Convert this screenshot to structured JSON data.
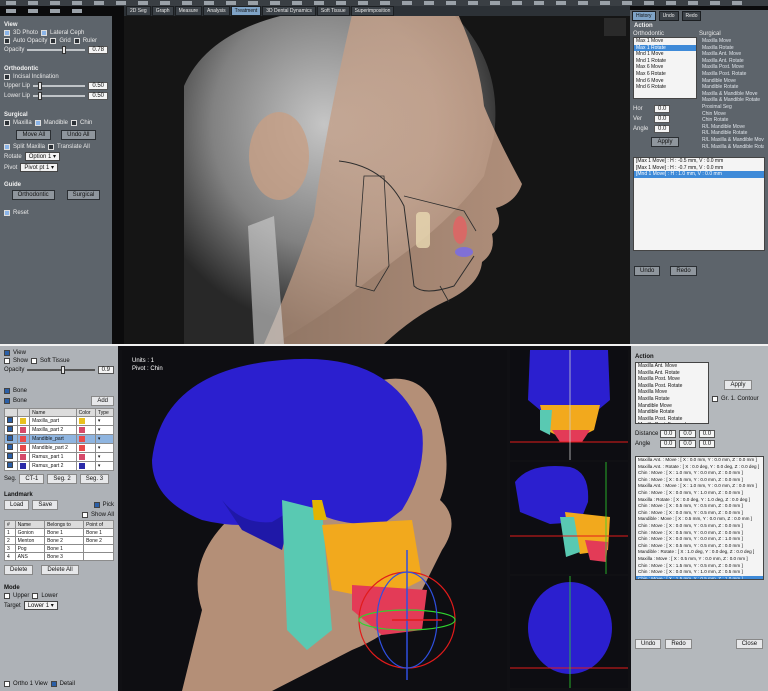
{
  "top_toolbar": {
    "tabs": [
      "2D Seg",
      "Graph",
      "Measure",
      "Analysis",
      "Treatment",
      "3D Dental Dynamics",
      "Soft Tissue",
      "Superimposition"
    ],
    "active_tab": "Treatment"
  },
  "top_left_panel": {
    "view_section": "View",
    "view_options": [
      "3D Photo",
      "Lateral Ceph",
      "Auto Opacity",
      "Grid",
      "Ruler"
    ],
    "opacity_label": "Opacity",
    "opacity_value": "0.78",
    "orthodontic_section": "Orthodontic",
    "orthodontic_option": "Incisal Inclination",
    "upper_lip_label": "Upper Lip",
    "upper_lip_value": "0.50",
    "lower_lip_label": "Lower Lip",
    "lower_lip_value": "0.50",
    "surgical_section": "Surgical",
    "surgical_options": [
      "Maxilla",
      "Mandible",
      "Chin"
    ],
    "button_a": "Move All",
    "button_b": "Undo All",
    "split_maxilla": "Split Maxilla",
    "translate_all": "Translate All",
    "rotate_label": "Rotate",
    "rotate_value": "Option 1",
    "pivot_label": "Pivot",
    "pivot_value": "Pivot pt 1",
    "guide_section": "Guide",
    "ortho_button": "Orthodontic",
    "surgical_button": "Surgical",
    "reset_label": "Reset"
  },
  "top_right_panel": {
    "tabs": [
      "History",
      "Undo",
      "Redo"
    ],
    "section": "Action",
    "col_orthodontic": "Orthodontic",
    "col_surgical": "Surgical",
    "ortho_items": [
      "Max 1 Move",
      "Max 1 Rotate",
      "Mnd 1 Move",
      "Mnd 1 Rotate",
      "Max 6 Move",
      "Max 6 Rotate",
      "Mnd 6 Move",
      "Mnd 6 Rotate"
    ],
    "ortho_selected": 1,
    "surgical_items": [
      "Maxilla Move",
      "Maxilla Rotate",
      "Maxilla Ant. Move",
      "Maxilla Ant. Rotate",
      "Maxilla Post. Move",
      "Maxilla Post. Rotate",
      "Mandible Move",
      "Mandible Rotate",
      "Maxilla & Mandible Move",
      "Maxilla & Mandible Rotate",
      "Proximal Seg",
      "Chin Move",
      "Chin Rotate",
      "R/L Mandible Move",
      "R/L Mandible Rotate",
      "R/L Maxilla & Mandible Move",
      "R/L Maxilla & Mandible Rotate"
    ],
    "field_labels": [
      "Hor",
      "Ver",
      "Angle"
    ],
    "field_values": [
      "0.0",
      "0.0",
      "0.0"
    ],
    "apply_button": "Apply",
    "history": [
      "[Max 1 Move] : H : -0.5 mm, V : 0.0 mm",
      "[Max 1 Move] : H : -0.7 mm, V : 0.0 mm",
      "[Mnd 1 Move] : H : 1.0 mm, V : 0.0 mm"
    ],
    "history_selected": 2,
    "undo_button": "Undo",
    "redo_button": "Redo"
  },
  "bottom_left_panel": {
    "view_section": "View",
    "show_label": "Show",
    "soft_tissue_label": "Soft Tissue",
    "opacity_label": "Opacity",
    "opacity_value": "0.9",
    "bone_section": "Bone",
    "bone_toggle": "Bone",
    "bone_button": "Add",
    "table_headers": [
      "",
      "",
      "Name",
      "Color",
      "Type"
    ],
    "bones": [
      {
        "name": "Maxilla_part",
        "color": "#e8c020"
      },
      {
        "name": "Maxilla_part 2",
        "color": "#d64a6a"
      },
      {
        "name": "Mandible_part",
        "color": "#e84a4a"
      },
      {
        "name": "Mandible_part 2",
        "color": "#e84a4a"
      },
      {
        "name": "Ramus_part 1",
        "color": "#d64a6a"
      },
      {
        "name": "Ramus_part 2",
        "color": "#2a2aa8"
      }
    ],
    "bones_selected": 2,
    "segment_label": "Seg.",
    "segment_buttons": [
      "CT-1",
      "Seg. 2",
      "Seg. 3"
    ],
    "landmark_section": "Landmark",
    "landmark_buttons": [
      "Load",
      "Save"
    ],
    "option_checks": [
      "Pick",
      "Show All"
    ],
    "lm_headers": [
      "#",
      "Name",
      "Belongs to",
      "Point of"
    ],
    "landmarks": [
      {
        "id": "1",
        "name": "Gonion",
        "belongs": "Bone 1",
        "point": "Bone 1"
      },
      {
        "id": "2",
        "name": "Menton",
        "belongs": "Bone 2",
        "point": "Bone 2"
      },
      {
        "id": "3",
        "name": "Pog",
        "belongs": "Bone 1",
        "point": ""
      },
      {
        "id": "4",
        "name": "ANS",
        "belongs": "Bone 3",
        "point": ""
      }
    ],
    "landmark_action_buttons": [
      "Delete",
      "Delete All"
    ],
    "mode_section": "Mode",
    "mode_options": [
      "Upper",
      "Lower"
    ],
    "mode_select_label": "Target",
    "mode_select_value": "Lower 1",
    "bottom_checks": [
      "Ortho 1 View",
      "Detail"
    ]
  },
  "viewport_bottom": {
    "info_line1": "Units : 1",
    "info_line2": "Pivot : Chin"
  },
  "bottom_right_panel": {
    "section": "Action",
    "actions": [
      "Maxilla Ant. Move",
      "Maxilla Ant. Rotate",
      "Maxilla Post. Move",
      "Maxilla Post. Rotate",
      "Maxilla Move",
      "Maxilla Rotate",
      "Mandible Move",
      "Mandible Rotate",
      "Maxilla Post. Rotate",
      "Maxilla Post. Forward",
      "Mandible Move",
      "Mandible Single Rotate",
      "Chin Move",
      "Chin Rotate"
    ],
    "actions_selected": 12,
    "apply_button": "Apply",
    "check_label": "Gr. 1. Contour",
    "fields_label": "Distance",
    "angle_label": "Angle",
    "field_values": [
      "0.0",
      "0.0",
      "0.0"
    ],
    "angle_values": [
      "0.0",
      "0.0",
      "0.0"
    ],
    "history": [
      "Maxilla Ant. : Move : [ X : 0.0 mm, Y : 0.0 mm, Z : 0.0 mm ]",
      "Maxilla Ant. : Rotate : [ X : 0.0 deg, Y : 0.0 deg, Z : 0.0 deg ]",
      "Chin : Move : [ X : 1.0 mm, Y : 0.0 mm, Z : 0.0 mm ]",
      "Chin : Move : [ X : 0.5 mm, Y : 0.0 mm, Z : 0.0 mm ]",
      "Maxilla Ant. : Move : [ X : 1.0 mm, Y : 0.0 mm, Z : 0.0 mm ]",
      "Chin : Move : [ X : 0.0 mm, Y : 1.0 mm, Z : 0.0 mm ]",
      "Maxilla : Rotate : [ X : 0.0 deg, Y : 1.0 deg, Z : 0.0 deg ]",
      "Chin : Move : [ X : 0.5 mm, Y : 0.5 mm, Z : 0.0 mm ]",
      "Chin : Move : [ X : 0.0 mm, Y : 0.5 mm, Z : 0.0 mm ]",
      "Mandible : Move : [ X : 0.5 mm, Y : 0.0 mm, Z : 0.0 mm ]",
      "Chin : Move : [ X : 0.0 mm, Y : 0.5 mm, Z : 0.0 mm ]",
      "Chin : Move : [ X : 0.5 mm, Y : 0.0 mm, Z : 0.0 mm ]",
      "Chin : Move : [ X : 0.0 mm, Y : 0.0 mm, Z : 1.0 mm ]",
      "Chin : Move : [ X : 0.5 mm, Y : 0.5 mm, Z : 0.0 mm ]",
      "Mandible : Rotate : [ X : 1.0 deg, Y : 0.0 deg, Z : 0.0 deg ]",
      "Maxilla : Move : [ X : 0.5 mm, Y : 0.0 mm, Z : 0.0 mm ]",
      "Chin : Move : [ X : 1.5 mm, Y : 0.5 mm, Z : 0.0 mm ]",
      "Chin : Move : [ X : 0.0 mm, Y : 1.0 mm, Z : 0.5 mm ]",
      "Chin : Move : [ X : 1.5 mm, Y : 0.5 mm, Z : 1.0 mm ]"
    ],
    "history_selected": 18,
    "undo_button": "Undo",
    "redo_button": "Redo",
    "close_button": "Close"
  }
}
